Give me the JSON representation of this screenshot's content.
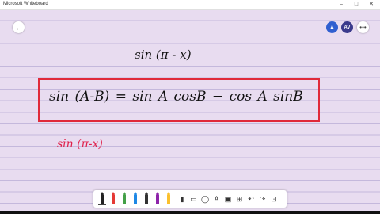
{
  "window": {
    "title": "Microsoft Whiteboard",
    "controls": [
      "–",
      "□",
      "✕"
    ]
  },
  "header": {
    "back_icon": "←",
    "person_icon": "person-icon",
    "person_glyph": "♟",
    "avatar_initials": "AV",
    "more_glyph": "•••"
  },
  "ink": {
    "line1": "sin (π - x)",
    "formula": "sin (A-B)  = sin A cosB − cos A sinB",
    "line3": "sin (π-x)"
  },
  "colors": {
    "background": "#e8dcf0",
    "box_border": "#e02a3a",
    "red_ink": "#e0204a",
    "black_ink": "#111111"
  },
  "toolbar": {
    "pens": [
      {
        "name": "pen-black",
        "color": "#222222"
      },
      {
        "name": "pen-red",
        "color": "#e53935"
      },
      {
        "name": "pen-green",
        "color": "#43a047"
      },
      {
        "name": "pen-blue",
        "color": "#1e88e5"
      },
      {
        "name": "pen-black-2",
        "color": "#333333"
      },
      {
        "name": "pen-purple",
        "color": "#8e24aa"
      },
      {
        "name": "pen-gold",
        "color": "#fbc02d"
      }
    ],
    "glyphs": [
      {
        "name": "highlighter-icon",
        "glyph": "▮"
      },
      {
        "name": "eraser-icon",
        "glyph": "▭"
      },
      {
        "name": "lasso-icon",
        "glyph": "◯"
      },
      {
        "name": "text-icon",
        "glyph": "A"
      },
      {
        "name": "image-icon",
        "glyph": "▣"
      },
      {
        "name": "shape-icon",
        "glyph": "⊞"
      },
      {
        "name": "undo-icon",
        "glyph": "↶"
      },
      {
        "name": "redo-icon",
        "glyph": "↷"
      },
      {
        "name": "ruler-icon",
        "glyph": "⊡"
      }
    ]
  }
}
